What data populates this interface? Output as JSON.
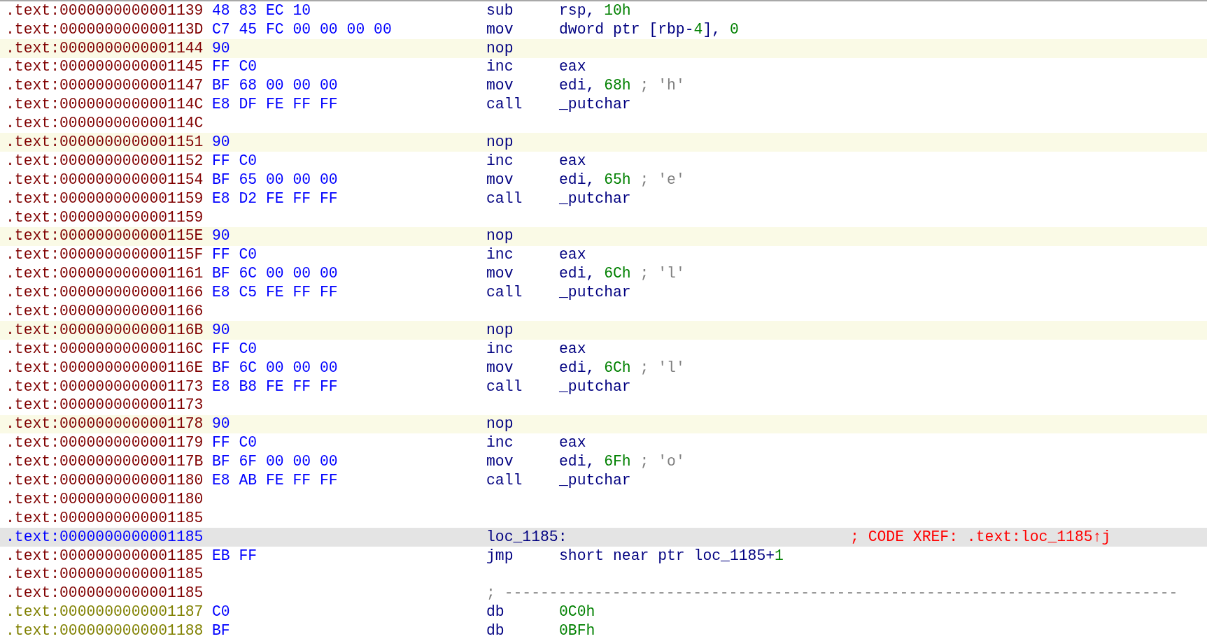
{
  "lines": [
    {
      "address": ".text:0000000000001139",
      "kind": "instr",
      "highlighted": false,
      "selected": false,
      "bytes": "48 83 EC 10",
      "mnemonic": "sub",
      "operands": [
        {
          "kind": "name",
          "text": "rsp, "
        },
        {
          "kind": "number",
          "text": "10h"
        }
      ]
    },
    {
      "address": ".text:000000000000113D",
      "kind": "instr",
      "highlighted": false,
      "selected": false,
      "bytes": "C7 45 FC 00 00 00 00",
      "mnemonic": "mov",
      "operands": [
        {
          "kind": "name",
          "text": "dword ptr [rbp-"
        },
        {
          "kind": "number",
          "text": "4"
        },
        {
          "kind": "name",
          "text": "], "
        },
        {
          "kind": "number",
          "text": "0"
        }
      ]
    },
    {
      "address": ".text:0000000000001144",
      "kind": "instr",
      "highlighted": true,
      "selected": false,
      "bytes": "90",
      "mnemonic": "nop"
    },
    {
      "address": ".text:0000000000001145",
      "kind": "instr",
      "highlighted": false,
      "selected": false,
      "bytes": "FF C0",
      "mnemonic": "inc",
      "operands": [
        {
          "kind": "name",
          "text": "eax"
        }
      ]
    },
    {
      "address": ".text:0000000000001147",
      "kind": "instr",
      "highlighted": false,
      "selected": false,
      "bytes": "BF 68 00 00 00",
      "mnemonic": "mov",
      "operands": [
        {
          "kind": "name",
          "text": "edi, "
        },
        {
          "kind": "number",
          "text": "68h"
        },
        {
          "kind": "comment",
          "text": " ; 'h'"
        }
      ]
    },
    {
      "address": ".text:000000000000114C",
      "kind": "instr",
      "highlighted": false,
      "selected": false,
      "bytes": "E8 DF FE FF FF",
      "mnemonic": "call",
      "operands": [
        {
          "kind": "name",
          "text": "_putchar"
        }
      ]
    },
    {
      "address": ".text:000000000000114C",
      "kind": "blank",
      "highlighted": false,
      "selected": false
    },
    {
      "address": ".text:0000000000001151",
      "kind": "instr",
      "highlighted": true,
      "selected": false,
      "bytes": "90",
      "mnemonic": "nop"
    },
    {
      "address": ".text:0000000000001152",
      "kind": "instr",
      "highlighted": false,
      "selected": false,
      "bytes": "FF C0",
      "mnemonic": "inc",
      "operands": [
        {
          "kind": "name",
          "text": "eax"
        }
      ]
    },
    {
      "address": ".text:0000000000001154",
      "kind": "instr",
      "highlighted": false,
      "selected": false,
      "bytes": "BF 65 00 00 00",
      "mnemonic": "mov",
      "operands": [
        {
          "kind": "name",
          "text": "edi, "
        },
        {
          "kind": "number",
          "text": "65h"
        },
        {
          "kind": "comment",
          "text": " ; 'e'"
        }
      ]
    },
    {
      "address": ".text:0000000000001159",
      "kind": "instr",
      "highlighted": false,
      "selected": false,
      "bytes": "E8 D2 FE FF FF",
      "mnemonic": "call",
      "operands": [
        {
          "kind": "name",
          "text": "_putchar"
        }
      ]
    },
    {
      "address": ".text:0000000000001159",
      "kind": "blank",
      "highlighted": false,
      "selected": false
    },
    {
      "address": ".text:000000000000115E",
      "kind": "instr",
      "highlighted": true,
      "selected": false,
      "bytes": "90",
      "mnemonic": "nop"
    },
    {
      "address": ".text:000000000000115F",
      "kind": "instr",
      "highlighted": false,
      "selected": false,
      "bytes": "FF C0",
      "mnemonic": "inc",
      "operands": [
        {
          "kind": "name",
          "text": "eax"
        }
      ]
    },
    {
      "address": ".text:0000000000001161",
      "kind": "instr",
      "highlighted": false,
      "selected": false,
      "bytes": "BF 6C 00 00 00",
      "mnemonic": "mov",
      "operands": [
        {
          "kind": "name",
          "text": "edi, "
        },
        {
          "kind": "number",
          "text": "6Ch"
        },
        {
          "kind": "comment",
          "text": " ; 'l'"
        }
      ]
    },
    {
      "address": ".text:0000000000001166",
      "kind": "instr",
      "highlighted": false,
      "selected": false,
      "bytes": "E8 C5 FE FF FF",
      "mnemonic": "call",
      "operands": [
        {
          "kind": "name",
          "text": "_putchar"
        }
      ]
    },
    {
      "address": ".text:0000000000001166",
      "kind": "blank",
      "highlighted": false,
      "selected": false
    },
    {
      "address": ".text:000000000000116B",
      "kind": "instr",
      "highlighted": true,
      "selected": false,
      "bytes": "90",
      "mnemonic": "nop"
    },
    {
      "address": ".text:000000000000116C",
      "kind": "instr",
      "highlighted": false,
      "selected": false,
      "bytes": "FF C0",
      "mnemonic": "inc",
      "operands": [
        {
          "kind": "name",
          "text": "eax"
        }
      ]
    },
    {
      "address": ".text:000000000000116E",
      "kind": "instr",
      "highlighted": false,
      "selected": false,
      "bytes": "BF 6C 00 00 00",
      "mnemonic": "mov",
      "operands": [
        {
          "kind": "name",
          "text": "edi, "
        },
        {
          "kind": "number",
          "text": "6Ch"
        },
        {
          "kind": "comment",
          "text": " ; 'l'"
        }
      ]
    },
    {
      "address": ".text:0000000000001173",
      "kind": "instr",
      "highlighted": false,
      "selected": false,
      "bytes": "E8 B8 FE FF FF",
      "mnemonic": "call",
      "operands": [
        {
          "kind": "name",
          "text": "_putchar"
        }
      ]
    },
    {
      "address": ".text:0000000000001173",
      "kind": "blank",
      "highlighted": false,
      "selected": false
    },
    {
      "address": ".text:0000000000001178",
      "kind": "instr",
      "highlighted": true,
      "selected": false,
      "bytes": "90",
      "mnemonic": "nop"
    },
    {
      "address": ".text:0000000000001179",
      "kind": "instr",
      "highlighted": false,
      "selected": false,
      "bytes": "FF C0",
      "mnemonic": "inc",
      "operands": [
        {
          "kind": "name",
          "text": "eax"
        }
      ]
    },
    {
      "address": ".text:000000000000117B",
      "kind": "instr",
      "highlighted": false,
      "selected": false,
      "bytes": "BF 6F 00 00 00",
      "mnemonic": "mov",
      "operands": [
        {
          "kind": "name",
          "text": "edi, "
        },
        {
          "kind": "number",
          "text": "6Fh"
        },
        {
          "kind": "comment",
          "text": " ; 'o'"
        }
      ]
    },
    {
      "address": ".text:0000000000001180",
      "kind": "instr",
      "highlighted": false,
      "selected": false,
      "bytes": "E8 AB FE FF FF",
      "mnemonic": "call",
      "operands": [
        {
          "kind": "name",
          "text": "_putchar"
        }
      ]
    },
    {
      "address": ".text:0000000000001180",
      "kind": "blank",
      "highlighted": false,
      "selected": false
    },
    {
      "address": ".text:0000000000001185",
      "kind": "blank",
      "highlighted": false,
      "selected": false
    },
    {
      "address": ".text:0000000000001185",
      "kind": "label",
      "highlighted": false,
      "selected": true,
      "label": "loc_1185:",
      "comment": "; CODE XREF: .text:loc_1185↑j"
    },
    {
      "address": ".text:0000000000001185",
      "kind": "instr",
      "highlighted": false,
      "selected": false,
      "bytes": "EB FF",
      "mnemonic": "jmp",
      "operands": [
        {
          "kind": "name",
          "text": "short near ptr loc_1185+"
        },
        {
          "kind": "number",
          "text": "1"
        }
      ]
    },
    {
      "address": ".text:0000000000001185",
      "kind": "blank",
      "highlighted": false,
      "selected": false
    },
    {
      "address": ".text:0000000000001185",
      "kind": "separator",
      "highlighted": false,
      "selected": false,
      "text": "; ---------------------------------------------------------------------------"
    },
    {
      "address": ".text:0000000000001187",
      "kind": "data",
      "highlighted": false,
      "selected": false,
      "bytes": "C0",
      "mnemonic": "db",
      "operands": [
        {
          "kind": "number",
          "text": "0C0h"
        }
      ]
    },
    {
      "address": ".text:0000000000001188",
      "kind": "data",
      "highlighted": false,
      "selected": false,
      "bytes": "BF",
      "mnemonic": "db",
      "operands": [
        {
          "kind": "number",
          "text": "0BFh"
        }
      ]
    }
  ]
}
